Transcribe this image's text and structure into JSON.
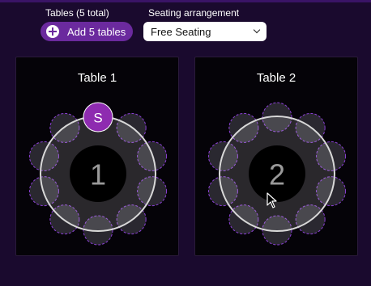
{
  "header": {
    "tables_label": "Tables (5 total)",
    "add_button_label": "Add 5 tables",
    "add_button_icon": "plus-circle-icon",
    "seating_label": "Seating arrangement",
    "seating_value": "Free Seating"
  },
  "colors": {
    "background": "#1a0a2e",
    "accent": "#6b2a9e",
    "seat_outline": "#8a3fd4",
    "occupied_seat": "#8e2bb0"
  },
  "tables": [
    {
      "title": "Table 1",
      "number": "1",
      "seats": 10,
      "occupied_seat_label": "S"
    },
    {
      "title": "Table 2",
      "number": "2",
      "seats": 10,
      "occupied_seat_label": ""
    }
  ]
}
